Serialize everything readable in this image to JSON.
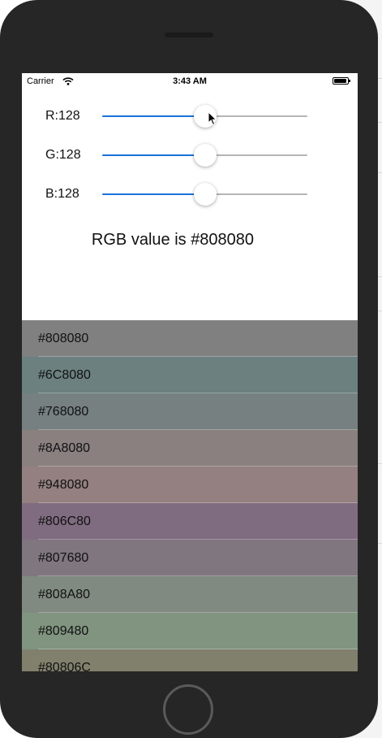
{
  "status_bar": {
    "carrier": "Carrier",
    "time": "3:43 AM"
  },
  "sliders": [
    {
      "label": "R:128",
      "value": 128,
      "max": 255
    },
    {
      "label": "G:128",
      "value": 128,
      "max": 255
    },
    {
      "label": "B:128",
      "value": 128,
      "max": 255
    }
  ],
  "rgb_value": "RGB value is #808080",
  "colors": [
    {
      "label": "#808080",
      "color": "#808080"
    },
    {
      "label": "#6C8080",
      "color": "#6C8080"
    },
    {
      "label": "#768080",
      "color": "#768080"
    },
    {
      "label": "#8A8080",
      "color": "#8A8080"
    },
    {
      "label": "#948080",
      "color": "#948080"
    },
    {
      "label": "#806C80",
      "color": "#806C80"
    },
    {
      "label": "#807680",
      "color": "#807680"
    },
    {
      "label": "#808A80",
      "color": "#808A80"
    },
    {
      "label": "#809480",
      "color": "#809480"
    },
    {
      "label": "#80806C",
      "color": "#80806C"
    }
  ],
  "theme": {
    "accent": "#1a73d9",
    "track": "#b5b5b5"
  }
}
